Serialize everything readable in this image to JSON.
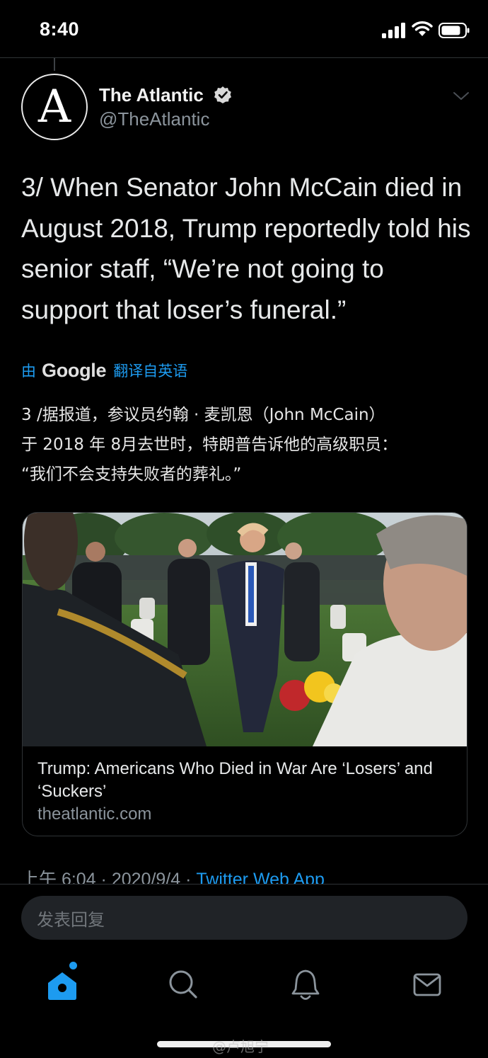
{
  "status_bar": {
    "time": "8:40"
  },
  "tweet": {
    "avatar_letter": "A",
    "display_name": "The Atlantic",
    "handle": "@TheAtlantic",
    "text": "3/ When Senator John McCain died in August 2018, Trump reportedly told his senior staff, “We’re not going to support that loser’s funeral.”",
    "translate": {
      "by": "由",
      "provider": "Google",
      "label": "翻译自英语"
    },
    "translated_text": "3 /据报道，参议员约翰 · 麦凯恩（John McCain）\n于 2018 年 8月去世时，特朗普告诉他的高级职员：\n“我们不会支持失败者的葬礼。”",
    "card": {
      "title": "Trump: Americans Who Died in War Are ‘Losers’ and ‘Suckers’",
      "domain": "theatlantic.com"
    },
    "meta": {
      "time": "上午 6:04",
      "sep1": " · ",
      "date": "2020/9/4",
      "sep2": " · ",
      "app": "Twitter Web App"
    }
  },
  "reply": {
    "placeholder": "发表回复"
  },
  "tabs": [
    "home-icon",
    "search-icon",
    "notifications-icon",
    "messages-icon"
  ],
  "watermark": "@卢旭宁",
  "colors": {
    "accent": "#1d9bf0",
    "background": "#000000",
    "muted": "#8b949c"
  }
}
